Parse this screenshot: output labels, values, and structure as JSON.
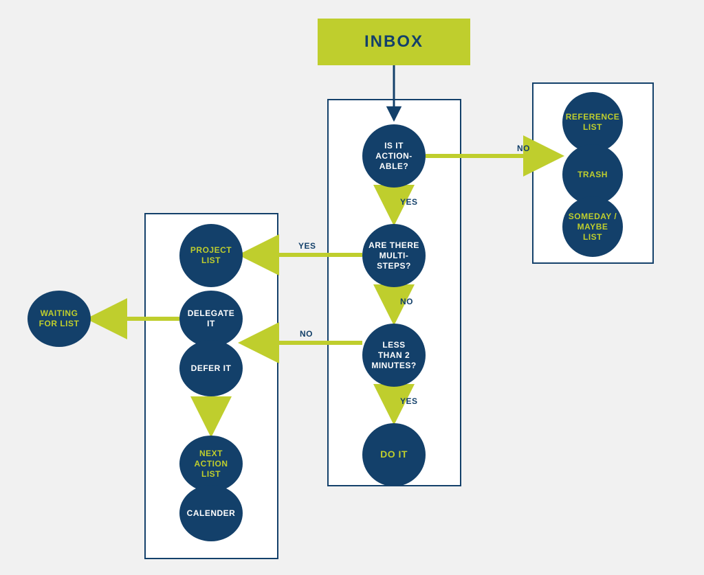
{
  "inbox": {
    "label": "INBOX"
  },
  "main_column": {
    "q1": "IS IT\nACTION-\nABLE?",
    "q2": "ARE THERE\nMULTI-\nSTEPS?",
    "q3": "LESS\nTHAN 2\nMINUTES?",
    "do_it": "DO IT"
  },
  "right_panel": {
    "reference": "REFERENCE\nLIST",
    "trash": "TRASH",
    "someday": "SOMEDAY /\nMAYBE LIST"
  },
  "left_panel": {
    "project_list": "PROJECT\nLIST",
    "delegate": "DELEGATE\nIT",
    "defer": "DEFER IT",
    "next_action": "NEXT\nACTION LIST",
    "calendar": "CALENDER"
  },
  "waiting": "WAITING\nFOR LIST",
  "edge_labels": {
    "actionable_no": "NO",
    "actionable_yes": "YES",
    "multi_yes": "YES",
    "multi_no": "NO",
    "two_min_no": "NO",
    "two_min_yes": "YES"
  },
  "colors": {
    "navy": "#13406a",
    "lime": "#bfce2d",
    "bg": "#f1f1f1"
  }
}
